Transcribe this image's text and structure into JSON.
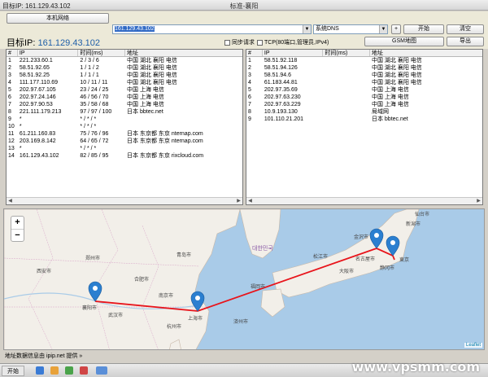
{
  "window": {
    "title_left": "目标IP: 161.129.43.102",
    "title_center": "标准-襄阳"
  },
  "toolbar": {
    "local_net_label": "本机网络",
    "address_value": "161.129.43.102",
    "dns_select": "系统DNS",
    "plus_label": "+",
    "start_label": "开始",
    "clear_label": "清空",
    "target_ip_label": "目标IP:",
    "target_ip_value": "161.129.43.102",
    "cb_sync": "同步请求",
    "cb_tcp": "TCP(80端口,管理员,IPv4)",
    "gsm_label": "GSM地图",
    "export_label": "导出"
  },
  "left_table": {
    "headers": [
      "#",
      "IP",
      "时间(ms)",
      "地址"
    ],
    "rows": [
      [
        "1",
        "221.233.60.1",
        "2 / 3 / 6",
        "中国 湖北 襄阳 电信"
      ],
      [
        "2",
        "58.51.92.65",
        "1 / 1 / 2",
        "中国 湖北 襄阳 电信"
      ],
      [
        "3",
        "58.51.92.25",
        "1 / 1 / 1",
        "中国 湖北 襄阳 电信"
      ],
      [
        "4",
        "111.177.110.69",
        "10 / 11 / 11",
        "中国 湖北 襄阳 电信"
      ],
      [
        "5",
        "202.97.67.105",
        "23 / 24 / 25",
        "中国 上海 电信"
      ],
      [
        "6",
        "202.97.24.146",
        "46 / 56 / 70",
        "中国 上海 电信"
      ],
      [
        "7",
        "202.97.90.53",
        "35 / 58 / 68",
        "中国 上海 电信"
      ],
      [
        "8",
        "221.111.179.213",
        "97 / 97 / 100",
        "日本 bbtec.net"
      ],
      [
        "9",
        "*",
        "* / * / *",
        ""
      ],
      [
        "10",
        "*",
        "* / * / *",
        ""
      ],
      [
        "11",
        "61.211.160.83",
        "75 / 76 / 96",
        "日本 东京都 东京 nternap.com"
      ],
      [
        "12",
        "203.169.8.142",
        "64 / 65 / 72",
        "日本 东京都 东京 nternap.com"
      ],
      [
        "13",
        "*",
        "* / * / *",
        ""
      ],
      [
        "14",
        "161.129.43.102",
        "82 / 85 / 95",
        "日本 东京都 东京 rixcloud.com"
      ]
    ]
  },
  "right_table": {
    "headers": [
      "#",
      "IP",
      "时间(ms)",
      "地址"
    ],
    "rows": [
      [
        "1",
        "58.51.92.118",
        "",
        "中国 湖北 襄阳 电信"
      ],
      [
        "2",
        "58.51.94.126",
        "",
        "中国 湖北 襄阳 电信"
      ],
      [
        "3",
        "58.51.94.6",
        "",
        "中国 湖北 襄阳 电信"
      ],
      [
        "4",
        "61.183.44.81",
        "",
        "中国 湖北 襄阳 电信"
      ],
      [
        "5",
        "202.97.35.69",
        "",
        "中国 上海 电信"
      ],
      [
        "6",
        "202.97.63.230",
        "",
        "中国 上海 电信"
      ],
      [
        "7",
        "202.97.63.229",
        "",
        "中国 上海 电信"
      ],
      [
        "8",
        "10.9.193.130",
        "",
        "局域网"
      ],
      [
        "9",
        "101.110.21.201",
        "",
        "日本 bbtec.net"
      ]
    ]
  },
  "map": {
    "zoom_in": "+",
    "zoom_out": "−",
    "attribution": "Leaflet",
    "labels": {
      "shanghai": "上海市",
      "tokyo": "東京",
      "nagoya": "名古屋市",
      "osaka": "大阪市",
      "fukuoka": "福岡市",
      "xiangyang": "襄阳市",
      "wuhan": "武汉市",
      "nanjing": "南京市",
      "hangzhou": "杭州市",
      "qingdao": "青岛市",
      "shizuoka": "静冈市",
      "korea": "대한민국",
      "kanazawa": "金沢市",
      "matsue": "松江市",
      "jeju": "済州市",
      "sendai": "仙台市",
      "niigata": "新潟市",
      "hefei": "合肥市",
      "zhengzhou": "郑州市",
      "xian": "西安市"
    },
    "route_color": "#e8141b",
    "marker_color": "#2b7fd0"
  },
  "status": {
    "text": "地址数据信息由 ipip.net 提供 »"
  },
  "taskbar": {
    "start_label": "开始"
  },
  "watermark": "www.vpsmm.com"
}
